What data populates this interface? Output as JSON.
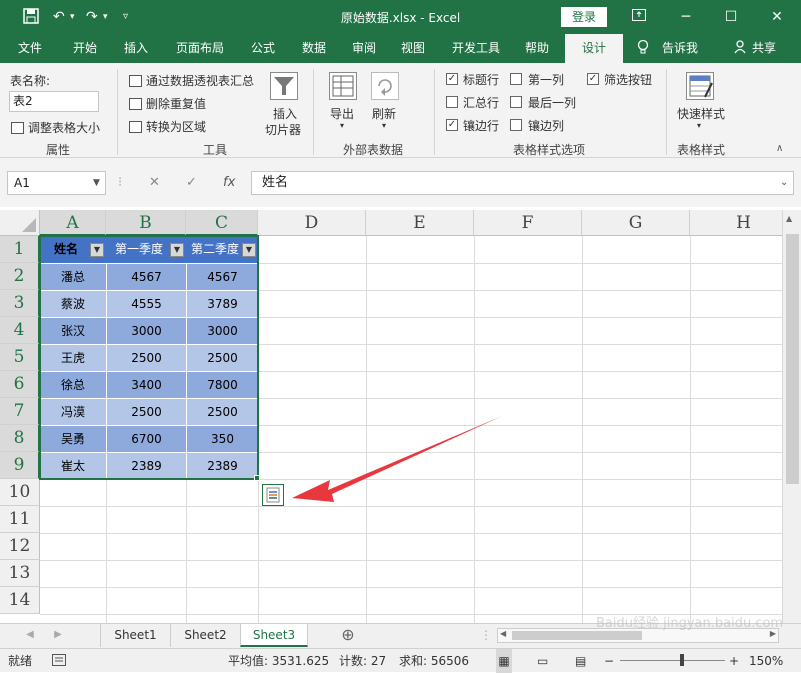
{
  "app": {
    "title": "原始数据.xlsx  -  Excel",
    "login": "登录"
  },
  "tabs": [
    "文件",
    "开始",
    "插入",
    "页面布局",
    "公式",
    "数据",
    "审阅",
    "视图",
    "开发工具",
    "帮助",
    "设计",
    "告诉我",
    "共享"
  ],
  "ribbon": {
    "table_name_label": "表名称:",
    "table_name_value": "表2",
    "resize": "调整表格大小",
    "properties_group": "属性",
    "pivot": "通过数据透视表汇总",
    "remove_dup": "删除重复值",
    "convert_range": "转换为区域",
    "insert_slicer_1": "插入",
    "insert_slicer_2": "切片器",
    "tools_group": "工具",
    "export": "导出",
    "refresh": "刷新",
    "external_group": "外部表数据",
    "header_row": "标题行",
    "first_col": "第一列",
    "filter_btn": "筛选按钮",
    "total_row": "汇总行",
    "last_col": "最后一列",
    "banded_rows": "镶边行",
    "banded_cols": "镶边列",
    "options_group": "表格样式选项",
    "quick_styles": "快速样式",
    "styles_group": "表格样式"
  },
  "formula_bar": {
    "name_box": "A1",
    "fx": "fx",
    "content": "姓名"
  },
  "columns": [
    "A",
    "B",
    "C",
    "D",
    "E",
    "F",
    "G",
    "H"
  ],
  "rows": [
    "1",
    "2",
    "3",
    "4",
    "5",
    "6",
    "7",
    "8",
    "9",
    "10",
    "11",
    "12",
    "13",
    "14"
  ],
  "table": {
    "headers": [
      "姓名",
      "第一季度",
      "第二季度"
    ],
    "data": [
      [
        "潘总",
        "4567",
        "4567"
      ],
      [
        "蔡波",
        "4555",
        "3789"
      ],
      [
        "张汉",
        "3000",
        "3000"
      ],
      [
        "王虎",
        "2500",
        "2500"
      ],
      [
        "徐总",
        "3400",
        "7800"
      ],
      [
        "冯漠",
        "2500",
        "2500"
      ],
      [
        "吴勇",
        "6700",
        "350"
      ],
      [
        "崔太",
        "2389",
        "2389"
      ]
    ]
  },
  "sheets": [
    "Sheet1",
    "Sheet2",
    "Sheet3"
  ],
  "status": {
    "ready": "就绪",
    "average": "平均值: 3531.625",
    "count": "计数: 27",
    "sum": "求和: 56506",
    "zoom": "150%"
  },
  "watermark": "Baidu经验 jingyan.baidu.com",
  "colors": {
    "excel_green": "#217346",
    "table_header": "#4472c4",
    "band_dark": "#8ea9db",
    "band_light": "#b4c6e7",
    "arrow": "#e8383d"
  }
}
